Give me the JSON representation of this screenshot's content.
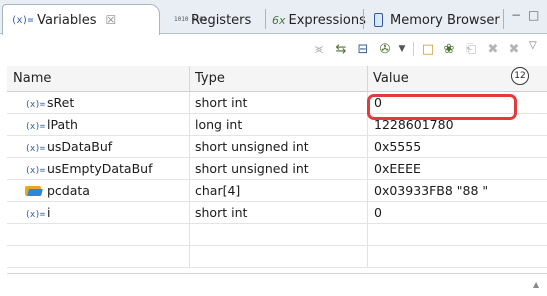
{
  "tabs": {
    "variables": {
      "icon_text": "(x)=",
      "label": "Variables",
      "close_glyph": "☒"
    },
    "registers": {
      "icon_text": "1010 0101",
      "label": "Registers"
    },
    "expressions": {
      "icon_text": "6x",
      "label": "Expressions"
    },
    "memory": {
      "label": "Memory Browser"
    },
    "window_controls": {
      "minimize": "−",
      "maximize": "□"
    }
  },
  "toolbar": {
    "icons": [
      "collapse-all-icon",
      "show-type-names-icon",
      "layout-icon",
      "select-columns-icon",
      "view-menu-icon",
      "new-icon",
      "add-watch-icon",
      "copy-icon",
      "remove-icon",
      "remove-all-icon"
    ],
    "chevron": "▽"
  },
  "table": {
    "columns": [
      "Name",
      "Type",
      "Value"
    ],
    "rows": [
      {
        "icon": "(x)=",
        "name": "sRet",
        "type": "short int",
        "value": "0"
      },
      {
        "icon": "(x)=",
        "name": "lPath",
        "type": "long int",
        "value": "1228601780"
      },
      {
        "icon": "(x)=",
        "name": "usDataBuf",
        "type": "short unsigned int",
        "value": "0x5555"
      },
      {
        "icon": "(x)=",
        "name": "usEmptyDataBuf",
        "type": "short unsigned int",
        "value": "0xEEEE"
      },
      {
        "icon": "folder",
        "name": "pcdata",
        "type": "char[4]",
        "value": "0x03933FB8 \"88  \""
      },
      {
        "icon": "(x)=",
        "name": "i",
        "type": "short int",
        "value": "0"
      }
    ]
  },
  "annotation": {
    "callout_number": "12",
    "highlight_color": "#e23b3b"
  },
  "colors": {
    "tabbar_bg": "#e9eef5",
    "header_bg": "#f5f5f5",
    "variable_icon": "#2f5aa8"
  }
}
